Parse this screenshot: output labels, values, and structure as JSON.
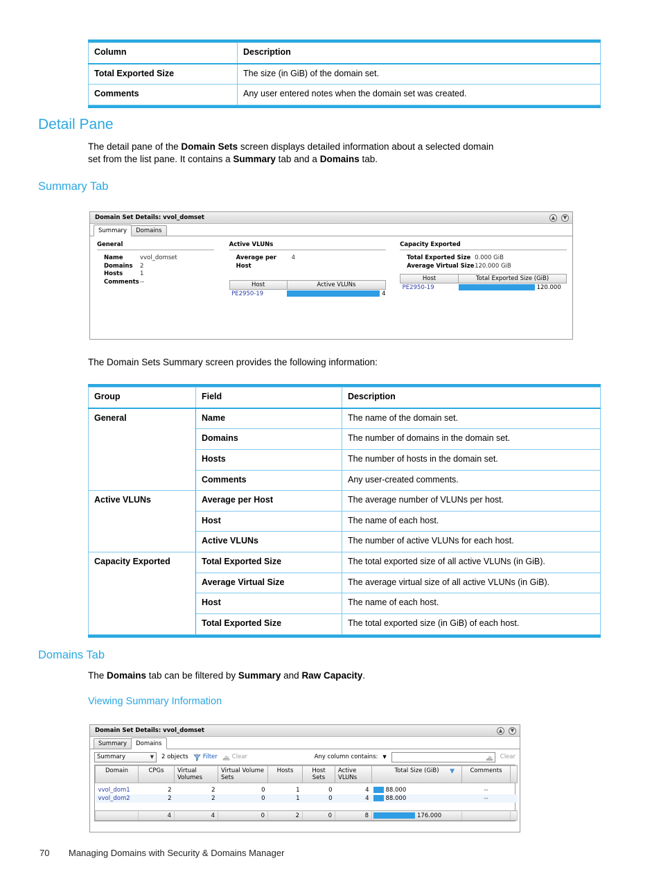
{
  "doc": {
    "top_table": {
      "headers": [
        "Column",
        "Description"
      ],
      "rows": [
        [
          "Total Exported Size",
          "The size (in GiB) of the domain set."
        ],
        [
          "Comments",
          "Any user entered notes when the domain set was created."
        ]
      ]
    },
    "heading_detail_pane": "Detail Pane",
    "para_detail_pane": {
      "p1": "The detail pane of the ",
      "b1": "Domain Sets",
      "p2": " screen displays detailed information about a selected domain",
      "p3": "set from the list pane. It contains a ",
      "b2": "Summary",
      "p4": " tab and a ",
      "b3": "Domains",
      "p5": " tab."
    },
    "heading_summary_tab": "Summary Tab",
    "para_provides": "The Domain Sets Summary screen provides the following information:",
    "main_table": {
      "headers": [
        "Group",
        "Field",
        "Description"
      ],
      "rows": [
        {
          "group": "General",
          "field": "Name",
          "description": "The name of the domain set.",
          "new_group": true
        },
        {
          "group": "",
          "field": "Domains",
          "description": "The number of domains in the domain set.",
          "new_group": false
        },
        {
          "group": "",
          "field": "Hosts",
          "description": "The number of hosts in the domain set.",
          "new_group": false
        },
        {
          "group": "",
          "field": "Comments",
          "description": "Any user-created comments.",
          "new_group": false
        },
        {
          "group": "Active VLUNs",
          "field": "Average per Host",
          "description": "The average number of VLUNs per host.",
          "new_group": true
        },
        {
          "group": "",
          "field": "Host",
          "description": "The name of each host.",
          "new_group": false
        },
        {
          "group": "",
          "field": "Active VLUNs",
          "description": "The number of active VLUNs for each host.",
          "new_group": false
        },
        {
          "group": "Capacity Exported",
          "field": "Total Exported Size",
          "description": "The total exported size of all active VLUNs (in GiB).",
          "new_group": true
        },
        {
          "group": "",
          "field": "Average Virtual Size",
          "description": "The average virtual size of all active VLUNs (in GiB).",
          "new_group": false
        },
        {
          "group": "",
          "field": "Host",
          "description": "The name of each host.",
          "new_group": false
        },
        {
          "group": "",
          "field": "Total Exported Size",
          "description": "The total exported size (in GiB) of each host.",
          "new_group": false
        }
      ]
    },
    "heading_domains_tab": "Domains Tab",
    "para_domains_tab": {
      "p1": "The ",
      "b1": "Domains",
      "p2": " tab can be filtered by ",
      "b2": "Summary",
      "p3": " and ",
      "b3": "Raw Capacity",
      "p4": "."
    },
    "heading_viewing_summary": "Viewing Summary Information",
    "footer": {
      "page_number": "70",
      "text": "Managing Domains with Security & Domains Manager"
    },
    "accent_color": "#29a8e0",
    "heading_color": "#2ba7e0"
  },
  "screenshot_summary": {
    "title": "Domain Set Details: vvol_domset",
    "title_icons": [
      "collapse-circle-icon",
      "close-circle-icon"
    ],
    "tabs": [
      {
        "label": "Summary",
        "active": true
      },
      {
        "label": "Domains",
        "active": false
      }
    ],
    "general": {
      "title": "General",
      "fields": [
        {
          "label": "Name",
          "value": "vvol_domset"
        },
        {
          "label": "Domains",
          "value": "2"
        },
        {
          "label": "Hosts",
          "value": "1"
        },
        {
          "label": "Comments",
          "value": "--"
        }
      ]
    },
    "active_vluns": {
      "title": "Active VLUNs",
      "average_label": "Average per Host",
      "average_value": "4",
      "table": {
        "headers": [
          "Host",
          "Active VLUNs"
        ],
        "rows": [
          {
            "host": "PE2950-19",
            "value": "4",
            "bar_pct": 100
          }
        ]
      }
    },
    "capacity_exported": {
      "title": "Capacity Exported",
      "fields": [
        {
          "label": "Total Exported Size",
          "value": "0.000 GiB"
        },
        {
          "label": "Average Virtual Size",
          "value": "120.000 GiB"
        }
      ],
      "table": {
        "headers": [
          "Host",
          "Total Exported Size (GiB)"
        ],
        "rows": [
          {
            "host": "PE2950-19",
            "value": "120.000",
            "bar_pct": 72
          }
        ]
      }
    }
  },
  "screenshot_domains": {
    "title": "Domain Set Details: vvol_domset",
    "title_icons": [
      "collapse-circle-icon",
      "close-circle-icon"
    ],
    "tabs": [
      {
        "label": "Summary",
        "active": false
      },
      {
        "label": "Domains",
        "active": true
      }
    ],
    "toolbar": {
      "view_select": "Summary",
      "object_count": "2 objects",
      "filter_label": "Filter",
      "clear_label": "Clear",
      "search_label": "Any column contains:",
      "search_value": "",
      "search_clear_label": "Clear"
    },
    "grid": {
      "headers": [
        "Domain",
        "CPGs",
        "Virtual Volumes",
        "Virtual Volume Sets",
        "Hosts",
        "Host Sets",
        "Active VLUNs",
        "Total Size (GiB)",
        "Comments"
      ],
      "sorted_column": "Total Size (GiB)",
      "sort_direction": "descending",
      "rows": [
        {
          "domain": "vvol_dom1",
          "cpgs": "2",
          "virtual_volumes": "2",
          "virtual_volume_sets": "0",
          "hosts": "1",
          "host_sets": "0",
          "active_vluns": "4",
          "total_size": "88.000",
          "bar_pct": 12,
          "comments": "--"
        },
        {
          "domain": "vvol_dom2",
          "cpgs": "2",
          "virtual_volumes": "2",
          "virtual_volume_sets": "0",
          "hosts": "1",
          "host_sets": "0",
          "active_vluns": "4",
          "total_size": "88.000",
          "bar_pct": 12,
          "comments": "--"
        }
      ],
      "total_row": {
        "domain": "",
        "cpgs": "4",
        "virtual_volumes": "4",
        "virtual_volume_sets": "0",
        "hosts": "2",
        "host_sets": "0",
        "active_vluns": "8",
        "total_size": "176.000",
        "bar_pct": 46,
        "comments": ""
      }
    }
  }
}
